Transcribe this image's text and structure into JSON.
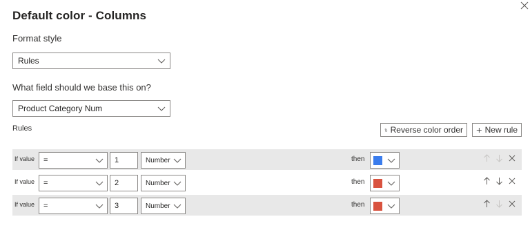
{
  "dialog": {
    "title": "Default color - Columns",
    "close_label": "✕"
  },
  "format_style": {
    "label": "Format style",
    "value": "Rules"
  },
  "base_field": {
    "label": "What field should we base this on?",
    "value": "Product Category Num"
  },
  "rules_section": {
    "label": "Rules",
    "reverse_label": "Reverse color order",
    "new_rule_label": "New rule"
  },
  "rules": [
    {
      "if_label": "If value",
      "operator": "=",
      "value": "1",
      "type": "Number",
      "then_label": "then",
      "color": "#3b7ded",
      "up_enabled": false,
      "down_enabled": false
    },
    {
      "if_label": "If value",
      "operator": "=",
      "value": "2",
      "type": "Number",
      "then_label": "then",
      "color": "#d9533f",
      "up_enabled": true,
      "down_enabled": true
    },
    {
      "if_label": "If value",
      "operator": "=",
      "value": "3",
      "type": "Number",
      "then_label": "then",
      "color": "#d9533f",
      "up_enabled": true,
      "down_enabled": false
    }
  ],
  "icons": {
    "close": "close-icon",
    "chevron": "chevron-down-icon",
    "reverse": "sort-arrows-icon",
    "add": "plus-icon",
    "up": "arrow-up-icon",
    "down": "arrow-down-icon",
    "delete": "delete-x-icon"
  }
}
